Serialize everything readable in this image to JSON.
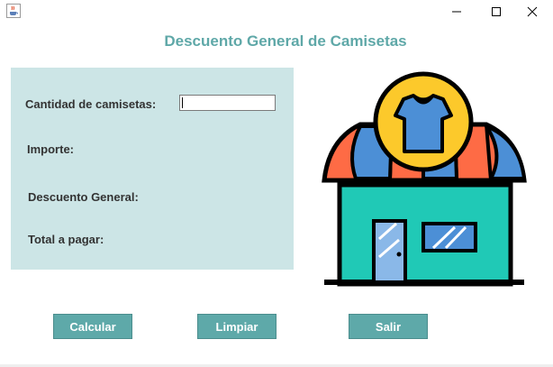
{
  "window": {
    "minimize_icon": "minimize-icon",
    "maximize_icon": "maximize-icon",
    "close_icon": "close-icon",
    "app_icon": "java-coffee-icon"
  },
  "title": "Descuento General de Camisetas",
  "form": {
    "cantidad_label": "Cantidad de camisetas:",
    "cantidad_value": "",
    "importe_label": "Importe:",
    "descuento_label": "Descuento General:",
    "total_label": "Total a pagar:"
  },
  "buttons": {
    "calcular": "Calcular",
    "limpiar": "Limpiar",
    "salir": "Salir"
  },
  "illustration": {
    "icon": "shop-tshirt-icon",
    "colors": {
      "awning_red": "#fe6b45",
      "awning_blue": "#4c8fd6",
      "badge_yellow": "#fcc92b",
      "shirt_blue": "#4c8fd6",
      "building_teal": "#20c9b6",
      "outline": "#000000"
    }
  },
  "colors": {
    "title": "#5fa8a8",
    "panel": "#cce5e6",
    "button": "#5ea9a9"
  }
}
